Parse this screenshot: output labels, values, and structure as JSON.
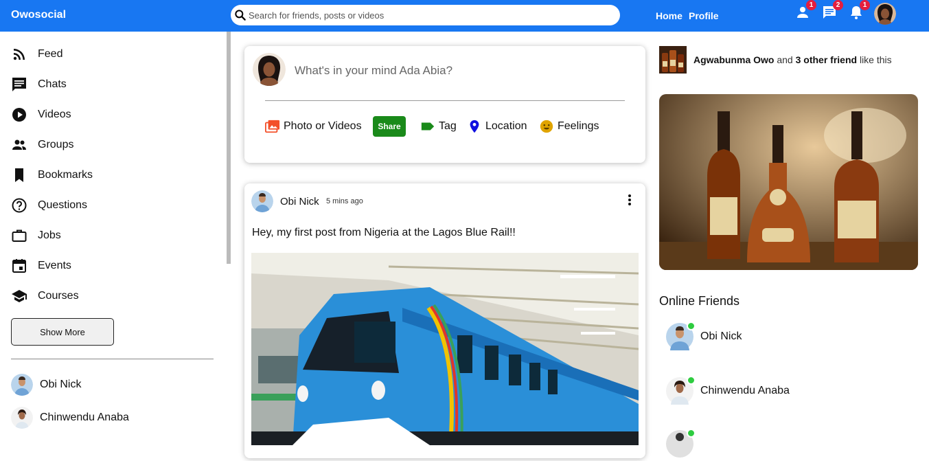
{
  "app": {
    "brand": "Owosocial"
  },
  "search": {
    "placeholder": "Search for friends, posts or videos"
  },
  "topnav": {
    "links": [
      "Home",
      "Profile"
    ],
    "notifications": {
      "friends": "1",
      "messages": "2",
      "alerts": "1"
    }
  },
  "sidebar": {
    "items": [
      {
        "label": "Feed",
        "icon": "rss-icon"
      },
      {
        "label": "Chats",
        "icon": "chat-icon"
      },
      {
        "label": "Videos",
        "icon": "play-circle-icon"
      },
      {
        "label": "Groups",
        "icon": "group-icon"
      },
      {
        "label": "Bookmarks",
        "icon": "bookmark-icon"
      },
      {
        "label": "Questions",
        "icon": "help-circle-icon"
      },
      {
        "label": "Jobs",
        "icon": "briefcase-icon"
      },
      {
        "label": "Events",
        "icon": "calendar-icon"
      },
      {
        "label": "Courses",
        "icon": "school-icon"
      }
    ],
    "show_more": "Show More",
    "friends": [
      "Obi Nick",
      "Chinwendu Anaba"
    ]
  },
  "share": {
    "prompt": "What's in your mind Ada Abia?",
    "options": {
      "photo": "Photo or Videos",
      "share_button": "Share",
      "tag": "Tag",
      "location": "Location",
      "feelings": "Feelings"
    },
    "colors": {
      "photo": "#f3502a",
      "share": "#1a8a1a",
      "tag": "#1a8a1a",
      "location": "#1010e0",
      "feelings": "#e0a400"
    }
  },
  "post": {
    "author": "Obi Nick",
    "time": "5 mins ago",
    "text": "Hey, my first post from Nigeria at the Lagos Blue Rail!!"
  },
  "rightbar": {
    "liker_name": "Agwabunma Owo",
    "liker_connector": "and",
    "liker_others": "3 other friend",
    "liker_suffix": "like this",
    "online_title": "Online Friends",
    "online_friends": [
      "Obi Nick",
      "Chinwendu Anaba"
    ]
  },
  "colors": {
    "topbar": "#1877f2",
    "online": "#2ecc40",
    "badge": "#e41e3f"
  }
}
